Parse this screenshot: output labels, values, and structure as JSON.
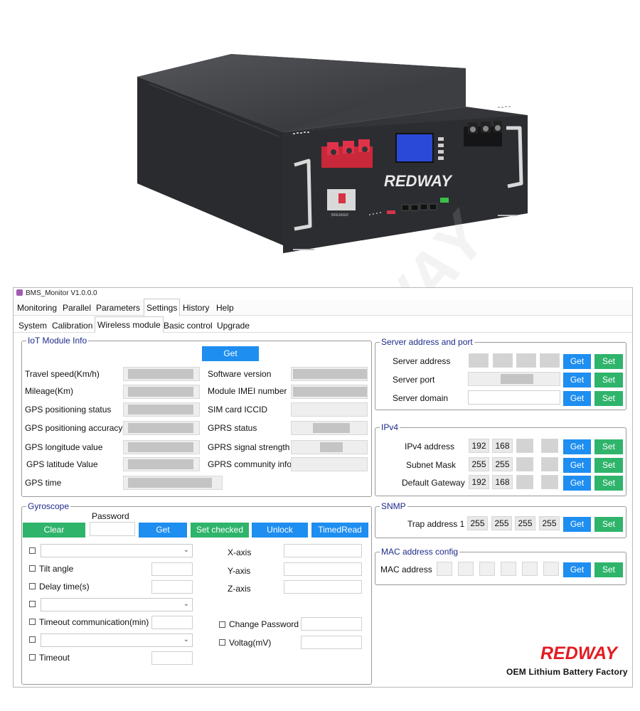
{
  "product": {
    "brand_on_panel": "REDWAY",
    "breaker_label": "BREAKER"
  },
  "window": {
    "title": "BMS_Monitor V1.0.0.0"
  },
  "menu": {
    "tabs": [
      "Monitoring",
      "Parallel",
      "Parameters",
      "Settings",
      "History",
      "Help"
    ],
    "active": "Settings"
  },
  "submenu": {
    "tabs": [
      "System",
      "Calibration",
      "Wireless module",
      "Basic control",
      "Upgrade"
    ],
    "active": "Wireless module"
  },
  "iot": {
    "legend": "IoT Module Info",
    "get_label": "Get",
    "left_labels": [
      "Travel speed(Km/h)",
      "Mileage(Km)",
      "GPS positioning status",
      "GPS positioning accuracy",
      "GPS longitude value",
      "GPS latitude Value",
      "GPS time"
    ],
    "right_labels": [
      "Software version",
      "Module IMEI number",
      "SIM card ICCID",
      "GPRS status",
      "GPRS signal strength",
      "GPRS community info"
    ]
  },
  "server": {
    "legend": "Server address and port",
    "address_label": "Server address",
    "port_label": "Server port",
    "domain_label": "Server domain",
    "get_label": "Get",
    "set_label": "Set"
  },
  "ipv4": {
    "legend": "IPv4",
    "rows": [
      {
        "label": "IPv4 address",
        "values": [
          "192",
          "168",
          "",
          ""
        ]
      },
      {
        "label": "Subnet Mask",
        "values": [
          "255",
          "255",
          "",
          ""
        ]
      },
      {
        "label": "Default Gateway",
        "values": [
          "192",
          "168",
          "",
          ""
        ]
      }
    ],
    "get_label": "Get",
    "set_label": "Set"
  },
  "snmp": {
    "legend": "SNMP",
    "label": "Trap address 1",
    "values": [
      "255",
      "255",
      "255",
      "255"
    ],
    "get_label": "Get",
    "set_label": "Set"
  },
  "mac": {
    "legend": "MAC address config",
    "label": "MAC address",
    "get_label": "Get",
    "set_label": "Set"
  },
  "gyro": {
    "legend": "Gyroscope",
    "password_label": "Password",
    "buttons": {
      "clear": "Clear",
      "get": "Get",
      "set_checked": "Set checked",
      "unlock": "Unlock",
      "timed_read": "TimedRead"
    },
    "tilt_label": "Tilt angle",
    "delay_label": "Delay time(s)",
    "timeout_comm_label": "Timeout communication(min)",
    "timeout_label": "Timeout",
    "x_label": "X-axis",
    "y_label": "Y-axis",
    "z_label": "Z-axis",
    "change_password_label": "Change Password",
    "voltage_label": "Voltag(mV)"
  },
  "watermark": "REDWAY",
  "footer": {
    "brand": "REDWAY",
    "tagline": "OEM Lithium Battery Factory"
  }
}
